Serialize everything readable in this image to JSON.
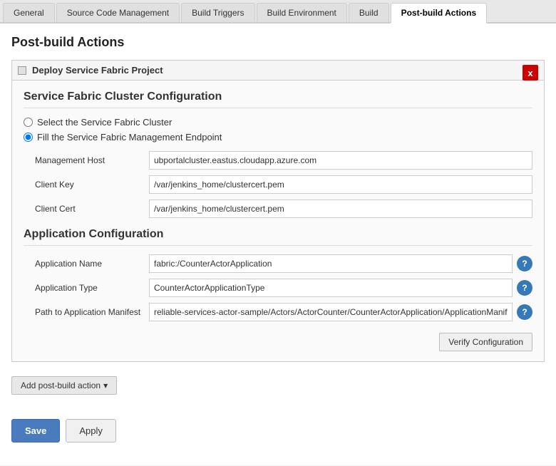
{
  "tabs": [
    {
      "id": "general",
      "label": "General",
      "active": false
    },
    {
      "id": "source-code-management",
      "label": "Source Code Management",
      "active": false
    },
    {
      "id": "build-triggers",
      "label": "Build Triggers",
      "active": false
    },
    {
      "id": "build-environment",
      "label": "Build Environment",
      "active": false
    },
    {
      "id": "build",
      "label": "Build",
      "active": false
    },
    {
      "id": "post-build-actions",
      "label": "Post-build Actions",
      "active": true
    }
  ],
  "page": {
    "title": "Post-build Actions"
  },
  "card": {
    "title": "Deploy Service Fabric Project",
    "close_label": "x"
  },
  "cluster_config": {
    "section_title": "Service Fabric Cluster Configuration",
    "radio_option1": "Select the Service Fabric Cluster",
    "radio_option2": "Fill the Service Fabric Management Endpoint",
    "radio1_selected": false,
    "radio2_selected": true,
    "fields": [
      {
        "label": "Management Host",
        "value": "ubportalcluster.eastus.cloudapp.azure.com",
        "help": false
      },
      {
        "label": "Client Key",
        "value": "/var/jenkins_home/clustercert.pem",
        "help": false
      },
      {
        "label": "Client Cert",
        "value": "/var/jenkins_home/clustercert.pem",
        "help": false
      }
    ]
  },
  "app_config": {
    "section_title": "Application Configuration",
    "fields": [
      {
        "label": "Application Name",
        "value": "fabric:/CounterActorApplication",
        "help": true
      },
      {
        "label": "Application Type",
        "value": "CounterActorApplicationType",
        "help": true
      },
      {
        "label": "Path to Application Manifest",
        "value": "reliable-services-actor-sample/Actors/ActorCounter/CounterActorApplication/ApplicationManifes",
        "help": true
      }
    ],
    "verify_btn_label": "Verify Configuration"
  },
  "add_action": {
    "label": "Add post-build action",
    "dropdown_icon": "▾"
  },
  "bottom_bar": {
    "save_label": "Save",
    "apply_label": "Apply"
  }
}
